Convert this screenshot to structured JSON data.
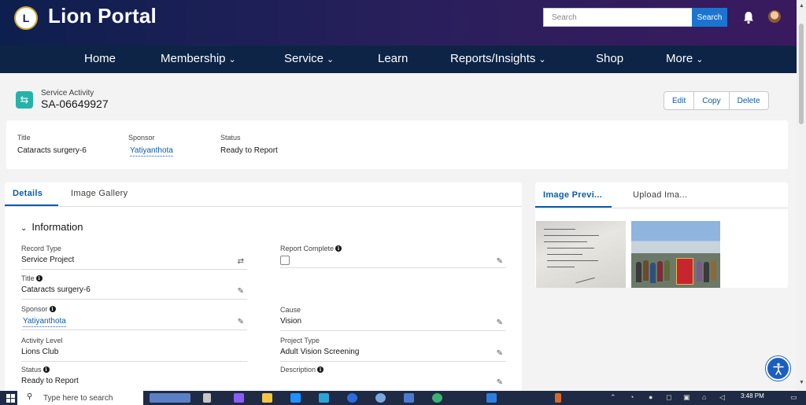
{
  "header": {
    "brand": "Lion Portal",
    "logo_text": "L",
    "search_placeholder": "Search",
    "search_button": "Search"
  },
  "nav": {
    "items": [
      {
        "label": "Home",
        "dropdown": false
      },
      {
        "label": "Membership",
        "dropdown": true
      },
      {
        "label": "Service",
        "dropdown": true
      },
      {
        "label": "Learn",
        "dropdown": false
      },
      {
        "label": "Reports/Insights",
        "dropdown": true
      },
      {
        "label": "Shop",
        "dropdown": false
      },
      {
        "label": "More",
        "dropdown": true
      }
    ],
    "chevron": "⌄"
  },
  "record": {
    "object_label": "Service Activity",
    "name": "SA-06649927",
    "actions": [
      "Edit",
      "Copy",
      "Delete"
    ]
  },
  "highlights": [
    {
      "label": "Title",
      "value": "Cataracts surgery-6"
    },
    {
      "label": "Sponsor",
      "value": "Yatiyanthota"
    },
    {
      "label": "Status",
      "value": "Ready to Report"
    }
  ],
  "tabs": [
    "Details",
    "Image Gallery"
  ],
  "section": "Information",
  "fields": {
    "record_type": {
      "label": "Record Type",
      "value": "Service Project"
    },
    "report_complete": {
      "label": "Report Complete",
      "checked": false
    },
    "title": {
      "label": "Title",
      "value": "Cataracts surgery-6"
    },
    "sponsor": {
      "label": "Sponsor",
      "value": "Yatiyanthota"
    },
    "cause": {
      "label": "Cause",
      "value": "Vision"
    },
    "activity_level": {
      "label": "Activity Level",
      "value": "Lions Club"
    },
    "project_type": {
      "label": "Project Type",
      "value": "Adult Vision Screening"
    },
    "status": {
      "label": "Status",
      "value": "Ready to Report"
    },
    "description": {
      "label": "Description",
      "value": ""
    }
  },
  "side_tabs": [
    "Image Previ...",
    "Upload Ima..."
  ],
  "taskbar": {
    "search_placeholder": "Type here to search",
    "time": "3:48 PM"
  },
  "colors": {
    "accent": "#0b5cab",
    "nav_bg": "#0d2447",
    "record_icon": "#26b2a9"
  }
}
